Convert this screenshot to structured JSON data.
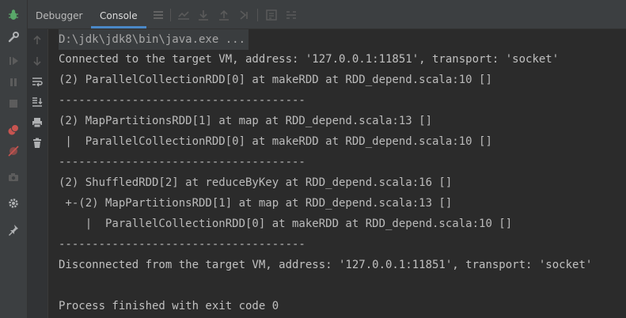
{
  "tabs": [
    {
      "label": "Debugger"
    },
    {
      "label": "Console"
    }
  ],
  "left_strip": {
    "icons": [
      "bug-icon",
      "wrench-icon",
      "resume-icon",
      "pause-icon",
      "stop-icon",
      "breakpoints-icon",
      "mute-breakpoints-icon",
      "camera-icon",
      "settings-icon",
      "pin-icon"
    ]
  },
  "side_tools": {
    "icons": [
      "arrow-up-icon",
      "arrow-down-icon",
      "soft-wrap-icon",
      "scroll-to-end-icon",
      "print-icon",
      "trash-icon"
    ]
  },
  "console": {
    "lines": [
      "D:\\jdk\\jdk8\\bin\\java.exe ...",
      "Connected to the target VM, address: '127.0.0.1:11851', transport: 'socket'",
      "(2) ParallelCollectionRDD[0] at makeRDD at RDD_depend.scala:10 []",
      "-------------------------------------",
      "(2) MapPartitionsRDD[1] at map at RDD_depend.scala:13 []",
      " |  ParallelCollectionRDD[0] at makeRDD at RDD_depend.scala:10 []",
      "-------------------------------------",
      "(2) ShuffledRDD[2] at reduceByKey at RDD_depend.scala:16 []",
      " +-(2) MapPartitionsRDD[1] at map at RDD_depend.scala:13 []",
      "    |  ParallelCollectionRDD[0] at makeRDD at RDD_depend.scala:10 []",
      "-------------------------------------",
      "Disconnected from the target VM, address: '127.0.0.1:11851', transport: 'socket'",
      "",
      "Process finished with exit code 0"
    ]
  },
  "colors": {
    "accent": "#4a88c7",
    "bug_green": "#59a869",
    "stop_red": "#c75450",
    "icon_gray": "#8c8c8c"
  }
}
